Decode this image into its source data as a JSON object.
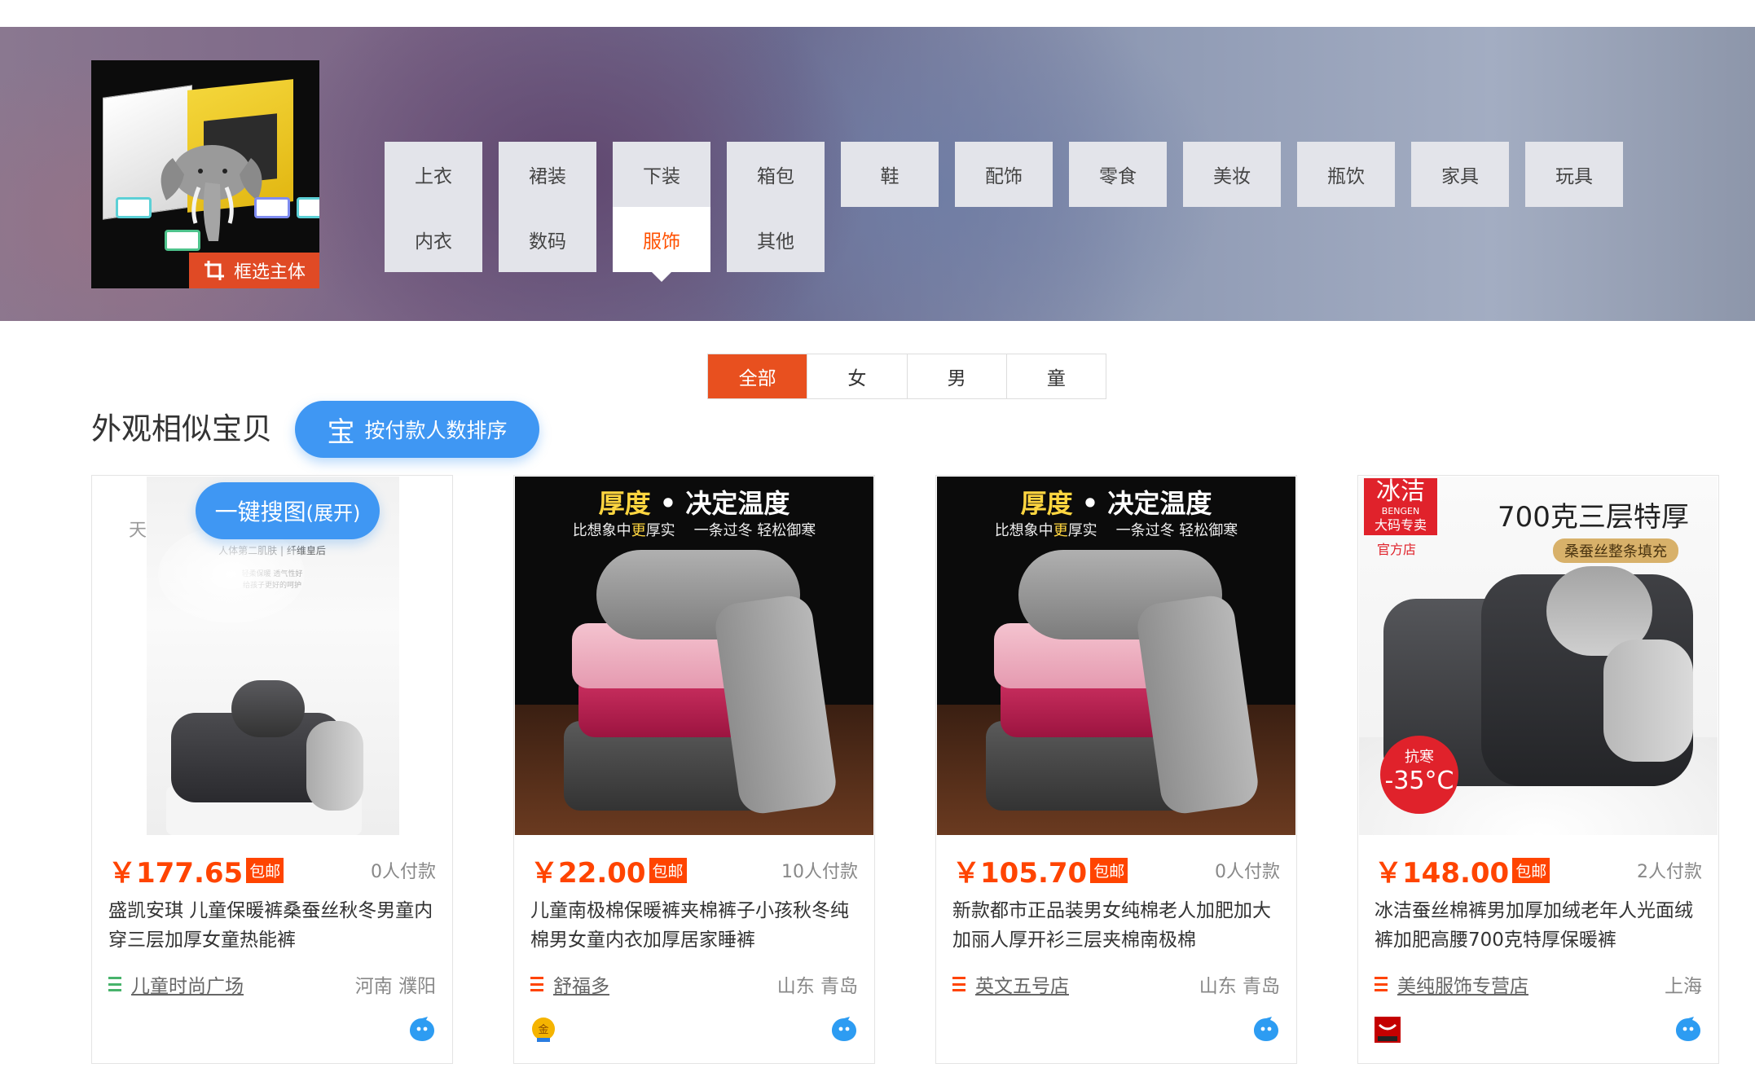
{
  "banner": {
    "crop_label": "框选主体",
    "categories": [
      {
        "label": "上衣",
        "active": false
      },
      {
        "label": "裙装",
        "active": false
      },
      {
        "label": "下装",
        "active": false
      },
      {
        "label": "箱包",
        "active": false
      },
      {
        "label": "鞋",
        "active": false
      },
      {
        "label": "配饰",
        "active": false
      },
      {
        "label": "零食",
        "active": false
      },
      {
        "label": "美妆",
        "active": false
      },
      {
        "label": "瓶饮",
        "active": false
      },
      {
        "label": "家具",
        "active": false
      },
      {
        "label": "玩具",
        "active": false
      },
      {
        "label": "内衣",
        "active": false
      },
      {
        "label": "数码",
        "active": false
      },
      {
        "label": "服饰",
        "active": true
      },
      {
        "label": "其他",
        "active": false
      }
    ]
  },
  "gender_tabs": [
    "全部",
    "女",
    "男",
    "童"
  ],
  "section": {
    "title": "外观相似宝贝",
    "sort_icon": "宝",
    "sort_label": "按付款人数排序",
    "search_label": "一键搜图",
    "search_suffix": "(展开)"
  },
  "products": [
    {
      "price": "￥177.65",
      "free_shipping": "包邮",
      "buyers": "0人付款",
      "title": "盛凯安琪 儿童保暖裤桑蚕丝秋冬男童内穿三层加厚女童热能裤",
      "shop": "儿童时尚广场",
      "shop_icon_color": "#47b36b",
      "location": "河南 濮阳",
      "badge": "none",
      "image_text": {
        "line1": "天",
        "line2": "人体第二肌肤 | 纤维皇后",
        "line3": "轻柔保暖 透气性好",
        "line4": "给孩子更好的呵护"
      }
    },
    {
      "price": "￥22.00",
      "free_shipping": "包邮",
      "buyers": "10人付款",
      "title": "儿童南极棉保暖裤夹棉裤子小孩秋冬纯棉男女童内衣加厚居家睡裤",
      "shop": "舒福多",
      "shop_icon_color": "#ff4400",
      "location": "山东 青岛",
      "badge": "gold",
      "image_text": {
        "head_a": "厚度",
        "dot": "•",
        "head_b": "决定温度",
        "sub_a": "比想象中",
        "sub_b": "更",
        "sub_c": "厚实",
        "sub_d": "一条过冬 轻松御寒"
      }
    },
    {
      "price": "￥105.70",
      "free_shipping": "包邮",
      "buyers": "0人付款",
      "title": "新款都市正品装男女纯棉老人加肥加大加丽人厚开衫三层夹棉南极棉",
      "shop": "英文五号店",
      "shop_icon_color": "#ff4400",
      "location": "山东 青岛",
      "badge": "none",
      "image_text": {
        "head_a": "厚度",
        "dot": "•",
        "head_b": "决定温度",
        "sub_a": "比想象中",
        "sub_b": "更",
        "sub_c": "厚实",
        "sub_d": "一条过冬 轻松御寒"
      }
    },
    {
      "price": "￥148.00",
      "free_shipping": "包邮",
      "buyers": "2人付款",
      "title": "冰洁蚕丝棉裤男加厚加绒老年人光面绒裤加肥高腰700克特厚保暖裤",
      "shop": "美纯服饰专营店",
      "shop_icon_color": "#ff4400",
      "location": "上海",
      "badge": "red",
      "image_text": {
        "brand": "冰洁",
        "brand_en": "BENGEN",
        "brand_sub": "大码专卖",
        "official": "官方店",
        "headline": "700克三层特厚",
        "pill": "桑蚕丝整条填充",
        "cold_a": "抗寒",
        "cold_b": "-35°C"
      }
    }
  ]
}
